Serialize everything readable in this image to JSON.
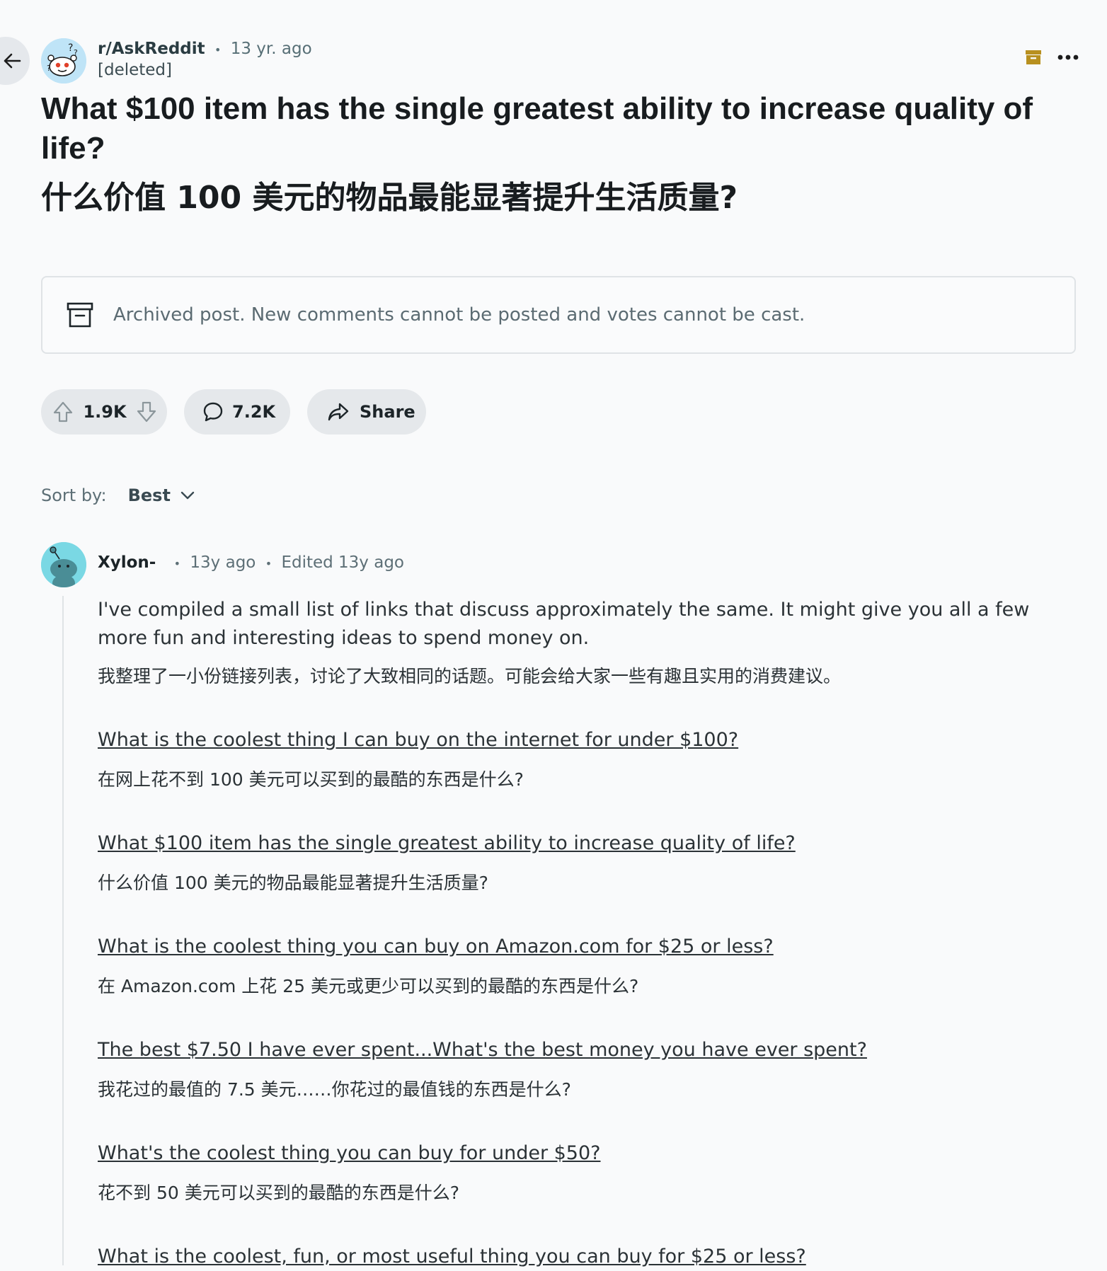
{
  "post": {
    "subreddit": "r/AskReddit",
    "separator": "•",
    "age": "13 yr. ago",
    "author": "[deleted]",
    "title_en": "What $100 item has the single greatest ability to increase quality of life?",
    "title_zh": "什么价值 100 美元的物品最能显著提升生活质量?"
  },
  "archived_notice": "Archived post. New comments cannot be posted and votes cannot be cast.",
  "actions": {
    "votes": "1.9K",
    "comments": "7.2K",
    "share": "Share"
  },
  "sort": {
    "label": "Sort by:",
    "value": "Best"
  },
  "comment": {
    "user": "Xylon-",
    "sep": "•",
    "age": "13y ago",
    "edited": "Edited 13y ago",
    "intro_en": "I've compiled a small list of links that discuss approximately the same. It might give you all a few more fun and interesting ideas to spend money on.",
    "intro_zh": "我整理了一小份链接列表，讨论了大致相同的话题。可能会给大家一些有趣且实用的消费建议。",
    "links": [
      {
        "en": "What is the coolest thing I can buy on the internet for under $100?",
        "zh": "在网上花不到 100 美元可以买到的最酷的东西是什么?"
      },
      {
        "en": "What $100 item has the single greatest ability to increase quality of life?",
        "zh": "什么价值 100 美元的物品最能显著提升生活质量?"
      },
      {
        "en": "What is the coolest thing you can buy on Amazon.com for $25 or less?",
        "zh": "在 Amazon.com 上花 25 美元或更少可以买到的最酷的东西是什么?"
      },
      {
        "en": "The best $7.50 I have ever spent...What's the best money you have ever spent?",
        "zh": "我花过的最值的 7.5 美元……你花过的最值钱的东西是什么?"
      },
      {
        "en": "What's the coolest thing you can buy for under $50?",
        "zh": "花不到 50 美元可以买到的最酷的东西是什么?"
      },
      {
        "en": "What is the coolest, fun, or most useful thing you can buy for $25 or less?",
        "zh": ""
      }
    ]
  },
  "colors": {
    "background": "#f9fafb",
    "pill": "#e5e8eb",
    "archive_icon_accent": "#b8901f",
    "avatar_commenter": "#7ad8e4"
  },
  "icons": {
    "back": "arrow-left-icon",
    "archive_badge": "archive-icon",
    "more": "ellipsis-icon",
    "upvote": "upvote-arrow-icon",
    "downvote": "downvote-arrow-icon",
    "comments": "speech-bubble-icon",
    "share": "share-arrow-icon",
    "sort_chevron": "chevron-down-icon"
  }
}
